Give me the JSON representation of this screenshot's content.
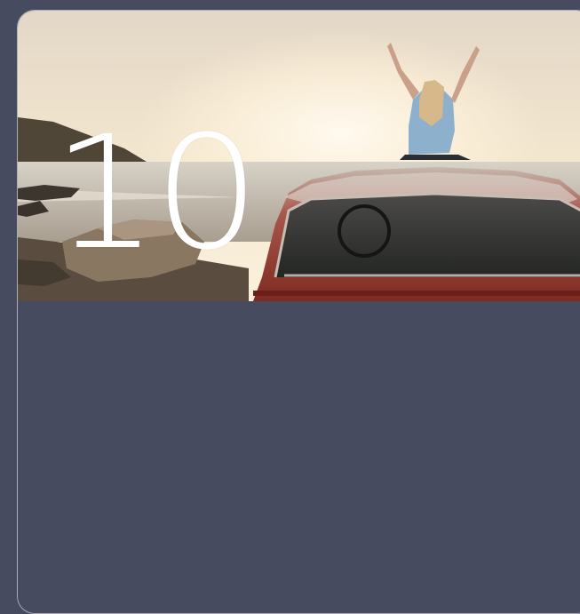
{
  "card": {
    "number": "10",
    "image_alt": "",
    "background_color": "#474b60",
    "number_color": "#ffffff"
  }
}
